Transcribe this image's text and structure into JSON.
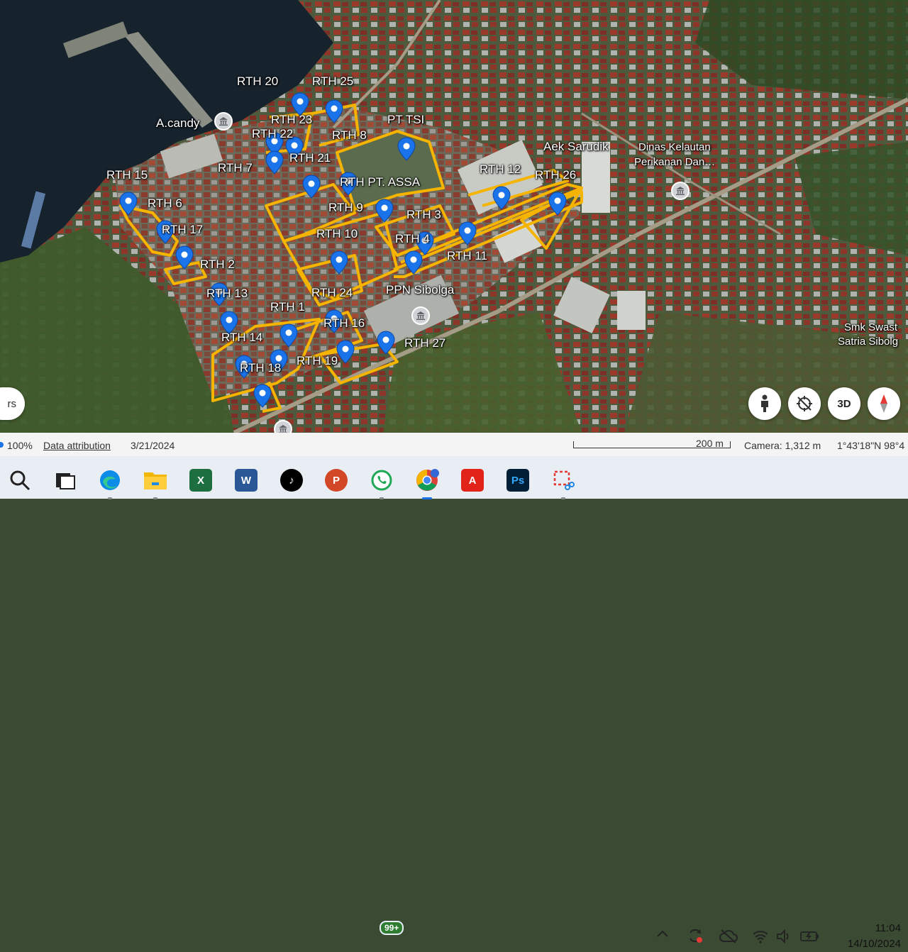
{
  "map": {
    "labels": {
      "rth20": "RTH 20",
      "rth25": "RTH 25",
      "rth23": "RTH 23",
      "pt_tsi": "PT TSI",
      "acandy": "A.candy",
      "rth22": "RTH 22",
      "rth8": "RTH 8",
      "aek_sarudik": "Aek Sarudik",
      "dinas_line1": "Dinas Kelautan",
      "dinas_line2": "Perikanan Dan…",
      "rth21": "RTH 21",
      "rth7": "RTH 7",
      "rth12": "RTH 12",
      "rth15": "RTH 15",
      "rth_pt_assa": "RTH PT. ASSA",
      "rth26": "RTH 26",
      "rth6": "RTH 6",
      "rth9": "RTH 9",
      "rth3": "RTH 3",
      "rth17": "RTH 17",
      "rth10": "RTH 10",
      "rth4": "RTH 4",
      "rth11": "RTH 11",
      "rth2": "RTH 2",
      "ppn": "PPN Sibolga",
      "rth13": "RTH 13",
      "rth24": "RTH 24",
      "rth1": "RTH 1",
      "rth16": "RTH 16",
      "rth14": "RTH 14",
      "rth27": "RTH 27",
      "rth19": "RTH 19",
      "rth18": "RTH 18",
      "smk_line1": "Smk Swast",
      "smk_line2": "Satria Sibolg"
    },
    "pin_color": "#1a73e8",
    "outline_color": "#f4b400",
    "controls": {
      "left_pill": "rs",
      "pegman": "pegman-icon",
      "orientation": "compass-reset-icon",
      "view_3d": "3D",
      "compass": "compass-icon"
    }
  },
  "status_bar": {
    "zoom": "100%",
    "attribution": "Data attribution",
    "imagery_date": "3/21/2024",
    "scale": "200 m",
    "camera": "Camera: 1,312 m",
    "coords": "1°43'18\"N 98°4"
  },
  "taskbar": {
    "apps": [
      "search-icon",
      "task-view-icon",
      "edge-icon",
      "file-explorer-icon",
      "excel-icon",
      "word-icon",
      "tiktok-icon",
      "powerpoint-icon",
      "whatsapp-icon",
      "chrome-icon",
      "acrobat-icon",
      "photoshop-icon",
      "snipping-tool-icon"
    ],
    "whatsapp_badge": "99+",
    "tray": [
      "chevron-up-icon",
      "sync-icon",
      "cloud-off-icon",
      "wifi-icon",
      "volume-icon",
      "battery-icon"
    ],
    "time": "11:04",
    "date": "14/10/2024"
  }
}
